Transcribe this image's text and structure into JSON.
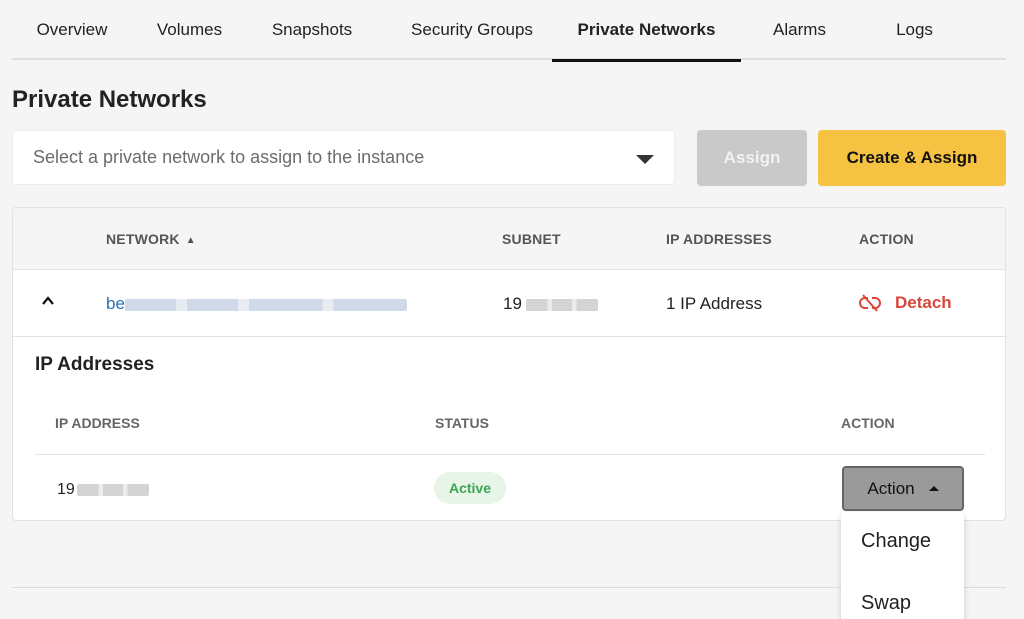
{
  "tabs": [
    {
      "label": "Overview"
    },
    {
      "label": "Volumes"
    },
    {
      "label": "Snapshots"
    },
    {
      "label": "Security Groups"
    },
    {
      "label": "Private Networks",
      "active": true
    },
    {
      "label": "Alarms"
    },
    {
      "label": "Logs"
    }
  ],
  "section": {
    "title": "Private Networks"
  },
  "select": {
    "placeholder": "Select a private network to assign to the instance"
  },
  "buttons": {
    "assign": "Assign",
    "create_assign": "Create & Assign"
  },
  "table": {
    "headers": {
      "network": "NETWORK",
      "subnet": "SUBNET",
      "ip_addresses": "IP ADDRESSES",
      "action": "ACTION"
    },
    "row": {
      "network_prefix": "be",
      "subnet_prefix": "19",
      "ip_count": "1 IP Address",
      "action": "Detach"
    }
  },
  "ip_section": {
    "title": "IP Addresses",
    "headers": {
      "ip": "IP ADDRESS",
      "status": "STATUS",
      "action": "ACTION"
    },
    "row": {
      "ip_prefix": "19",
      "status": "Active",
      "action_label": "Action"
    }
  },
  "action_menu": {
    "items": [
      "Change",
      "Swap"
    ]
  },
  "colors": {
    "accent": "#f5c242",
    "link": "#2b6fb5",
    "danger": "#d9473b",
    "success": "#3ca552"
  },
  "icons": {
    "sort": "sort-icon",
    "expand": "chevron-up-icon",
    "detach": "unlink-icon",
    "dropdown": "caret-down-icon"
  }
}
